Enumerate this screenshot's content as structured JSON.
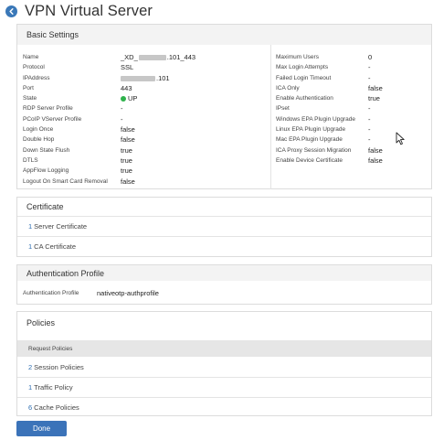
{
  "header": {
    "title": "VPN Virtual Server",
    "back_icon": "back-arrow-icon"
  },
  "basic_settings": {
    "title": "Basic Settings",
    "left": [
      {
        "key": "Name",
        "value_prefix": "_XD_",
        "value_suffix": ".101_443"
      },
      {
        "key": "Protocol",
        "value": "SSL"
      },
      {
        "key": "IPAddress",
        "value_suffix": ".101"
      },
      {
        "key": "Port",
        "value": "443"
      },
      {
        "key": "State",
        "value": "UP",
        "status_color": "#2fb24c"
      },
      {
        "key": "RDP Server Profile",
        "value": "-"
      },
      {
        "key": "PCoIP VServer Profile",
        "value": "-"
      },
      {
        "key": "Login Once",
        "value": "false"
      },
      {
        "key": "Double Hop",
        "value": "false"
      },
      {
        "key": "Down State Flush",
        "value": "true"
      },
      {
        "key": "DTLS",
        "value": "true"
      },
      {
        "key": "AppFlow Logging",
        "value": "true"
      },
      {
        "key": "Logout On Smart Card Removal",
        "value": "false"
      }
    ],
    "right": [
      {
        "key": "Maximum Users",
        "value": "0"
      },
      {
        "key": "Max Login Attempts",
        "value": "-"
      },
      {
        "key": "Failed Login Timeout",
        "value": "-"
      },
      {
        "key": "ICA Only",
        "value": "false"
      },
      {
        "key": "Enable Authentication",
        "value": "true"
      },
      {
        "key": "IPset",
        "value": "-"
      },
      {
        "key": "Windows EPA Plugin Upgrade",
        "value": "-"
      },
      {
        "key": "Linux EPA Plugin Upgrade",
        "value": "-"
      },
      {
        "key": "Mac EPA Plugin Upgrade",
        "value": "-"
      },
      {
        "key": "ICA Proxy Session Migration",
        "value": "false"
      },
      {
        "key": "Enable Device Certificate",
        "value": "false"
      }
    ]
  },
  "certificate": {
    "title": "Certificate",
    "items": [
      {
        "count": "1",
        "label": "Server Certificate"
      },
      {
        "count": "1",
        "label": "CA Certificate"
      }
    ]
  },
  "authentication": {
    "title": "Authentication Profile",
    "key": "Authentication Profile",
    "value": "nativeotp-authprofile"
  },
  "policies": {
    "title": "Policies",
    "request_header": "Request Policies",
    "items": [
      {
        "count": "2",
        "label": "Session Policies"
      },
      {
        "count": "1",
        "label": "Traffic Policy"
      },
      {
        "count": "6",
        "label": "Cache Policies"
      }
    ]
  },
  "footer": {
    "done_label": "Done",
    "accent": "#3b73b9"
  }
}
